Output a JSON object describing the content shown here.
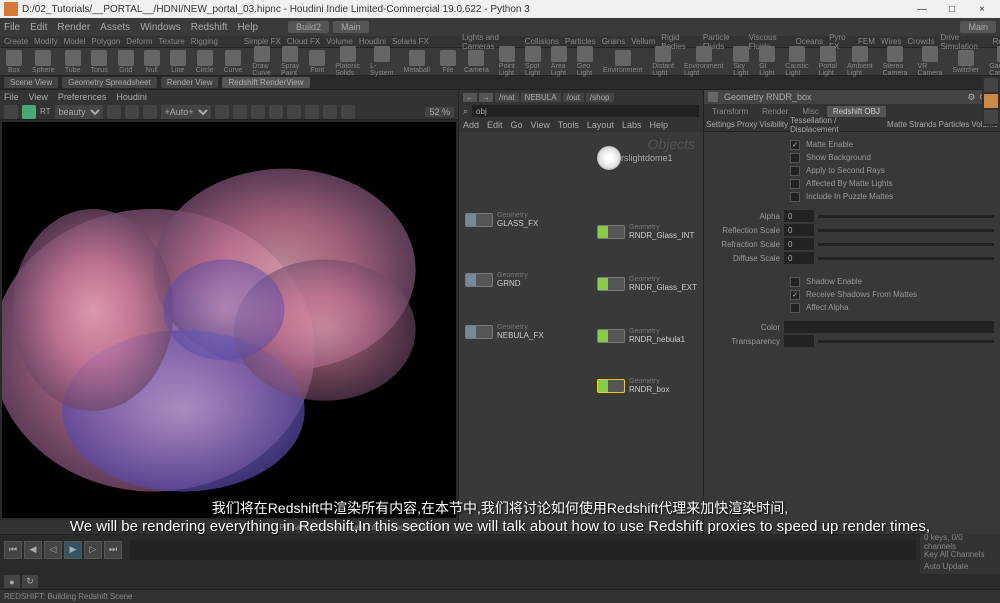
{
  "titlebar": {
    "path": "D:/02_Tutorials/__PORTAL__/HDNI/NEW_portal_03.hipnc - Houdini Indie Limited-Commercial 19.0.622 - Python 3"
  },
  "menu": [
    "File",
    "Edit",
    "Render",
    "Assets",
    "Windows",
    "Redshift",
    "Help"
  ],
  "scene_tabs": [
    "Build2",
    "Main"
  ],
  "scene_right": "Main",
  "shelf_tabs_left": [
    "Create",
    "Modify",
    "Model",
    "Polygon",
    "Deform",
    "Texture",
    "Rigging"
  ],
  "shelf_tools_left": [
    "Box",
    "Sphere",
    "Tube",
    "Torus",
    "Grid",
    "Null",
    "Line",
    "Circle",
    "Curve",
    "Draw Curve",
    "Spray Paint",
    "Font",
    "Platonic Solids",
    "L-System",
    "Metaball",
    "File"
  ],
  "shelf_tabs_right": [
    "Lights and Cameras",
    "Collisions",
    "Particles",
    "Grains",
    "Vellum",
    "Rigid Bodies",
    "Particle Fluids",
    "Viscous Fluids",
    "Oceans",
    "Pyro FX",
    "FEM",
    "Wires",
    "Crowds",
    "Drive Simulation",
    "Redshift"
  ],
  "shelf_tabs_mid": [
    "Simple FX",
    "Cloud FX",
    "Volume",
    "Houdini",
    "Solaris FX"
  ],
  "shelf_tools_right": [
    "Camera",
    "Point Light",
    "Spot Light",
    "Area Light",
    "Geo Light",
    "Environment",
    "Distant Light",
    "Environment Light",
    "Sky Light",
    "GI Light",
    "Caustic Light",
    "Portal Light",
    "Ambient Light",
    "Stereo Camera",
    "VR Camera",
    "Switcher",
    "Gamepad Camera"
  ],
  "view_tabs": [
    "Scene View",
    "Geometry Spreadsheet",
    "Render View",
    "Redshift RenderView"
  ],
  "lp_menu": [
    "File",
    "View",
    "Preferences",
    "Houdini"
  ],
  "lp_aov": "beauty",
  "lp_auto": "+Auto+",
  "lp_zoom": "52 %",
  "lp_status": "Preparing first few levels of ray tracing hierarchy",
  "net_path": [
    "/mat",
    "NEBULA",
    "/out",
    "/shop"
  ],
  "net_search": "obj",
  "net_menu": [
    "Add",
    "Edit",
    "Go",
    "View",
    "Tools",
    "Layout",
    "Labs",
    "Help"
  ],
  "objects_label": "Objects",
  "nodes": {
    "light": {
      "label": "rslightdome1"
    },
    "glass_fx": {
      "type": "Geometry",
      "label": "GLASS_FX"
    },
    "grnd": {
      "type": "Geometry",
      "label": "GRND"
    },
    "nebula_fx": {
      "type": "Geometry",
      "label": "NEBULA_FX"
    },
    "glass_int": {
      "type": "Geometry",
      "label": "RNDR_Glass_INT"
    },
    "glass_ext": {
      "type": "Geometry",
      "label": "RNDR_Glass_EXT"
    },
    "nebula1": {
      "type": "Geometry",
      "label": "RNDR_nebula1"
    },
    "box": {
      "type": "Geometry",
      "label": "RNDR_box"
    }
  },
  "params": {
    "title": "Geometry  RNDR_box",
    "tabs1": [
      "Transform",
      "Render",
      "Misc",
      "Redshift OBJ"
    ],
    "tabs2": [
      "Settings",
      "Proxy",
      "Visibility",
      "Tessellation / Displacement",
      "Matte",
      "Strands",
      "Particles",
      "Volume"
    ],
    "active1": "Redshift OBJ",
    "active2": "Matte",
    "checks": [
      {
        "label": "Matte Enable",
        "on": true
      },
      {
        "label": "Show Background",
        "on": false
      },
      {
        "label": "Apply to Second Rays",
        "on": false
      },
      {
        "label": "Affected By Matte Lights",
        "on": false
      },
      {
        "label": "Include In Puzzle Mattes",
        "on": false
      }
    ],
    "sliders": [
      {
        "label": "Alpha",
        "val": "0"
      },
      {
        "label": "Reflection Scale",
        "val": "0"
      },
      {
        "label": "Refraction Scale",
        "val": "0"
      },
      {
        "label": "Diffuse Scale",
        "val": "0"
      }
    ],
    "shadow_checks": [
      {
        "label": "Shadow Enable",
        "on": false
      },
      {
        "label": "Receive Shadows From Mattes",
        "on": true
      },
      {
        "label": "Affect Alpha",
        "on": false
      }
    ],
    "color_label": "Color",
    "trans_label": "Transparency"
  },
  "dock": {
    "keys": "0 keys, 0/0 channels",
    "key_all": "Key All Channels",
    "auto": "Auto Update"
  },
  "statusbar": "REDSHIFT: Building Redshift Scene",
  "subtitle": {
    "cn": "我们将在Redshift中渲染所有内容,在本节中,我们将讨论如何使用Redshift代理来加快渲染时间,",
    "en": "We will be rendering everything in Redshift,In this section we will talk about how to use Redshift proxies to speed up render times,"
  }
}
